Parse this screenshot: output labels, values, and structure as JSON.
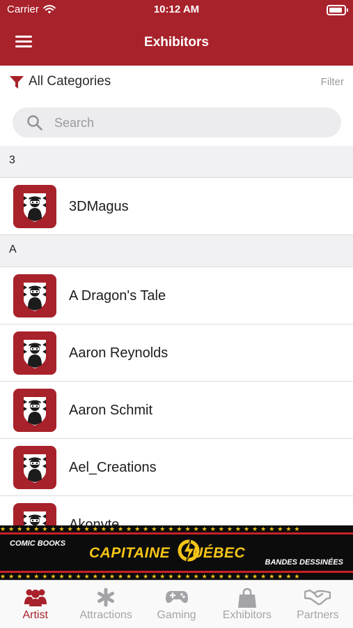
{
  "status": {
    "carrier": "Carrier",
    "time": "10:12 AM",
    "battery_level": 0.9
  },
  "nav": {
    "title": "Exhibitors",
    "menu_icon": "hamburger-menu-icon"
  },
  "filter": {
    "category": "All Categories",
    "filter_label": "Filter",
    "icon": "funnel-icon"
  },
  "search": {
    "placeholder": "Search",
    "value": "",
    "icon": "magnifier-icon"
  },
  "sections": [
    {
      "header": "3",
      "items": [
        "3DMagus"
      ]
    },
    {
      "header": "A",
      "items": [
        "A Dragon's Tale",
        "Aaron Reynolds",
        "Aaron Schmit",
        "Ael_Creations",
        "Akonyte"
      ]
    }
  ],
  "banner": {
    "left_text": "COMIC BOOKS",
    "brand_part1": "CAPITAINE",
    "brand_part2": "UÉBEC",
    "right_text": "BANDES DESSINÉES"
  },
  "tabs": [
    {
      "label": "Artist",
      "icon": "people-icon",
      "active": true
    },
    {
      "label": "Attractions",
      "icon": "asterisk-icon",
      "active": false
    },
    {
      "label": "Gaming",
      "icon": "gamepad-icon",
      "active": false
    },
    {
      "label": "Exhibitors",
      "icon": "shopping-bag-icon",
      "active": false
    },
    {
      "label": "Partners",
      "icon": "handshake-icon",
      "active": false
    }
  ],
  "colors": {
    "brand": "#a8222b",
    "tab_inactive": "#a4a4a8",
    "banner_gold": "#f5c518"
  }
}
